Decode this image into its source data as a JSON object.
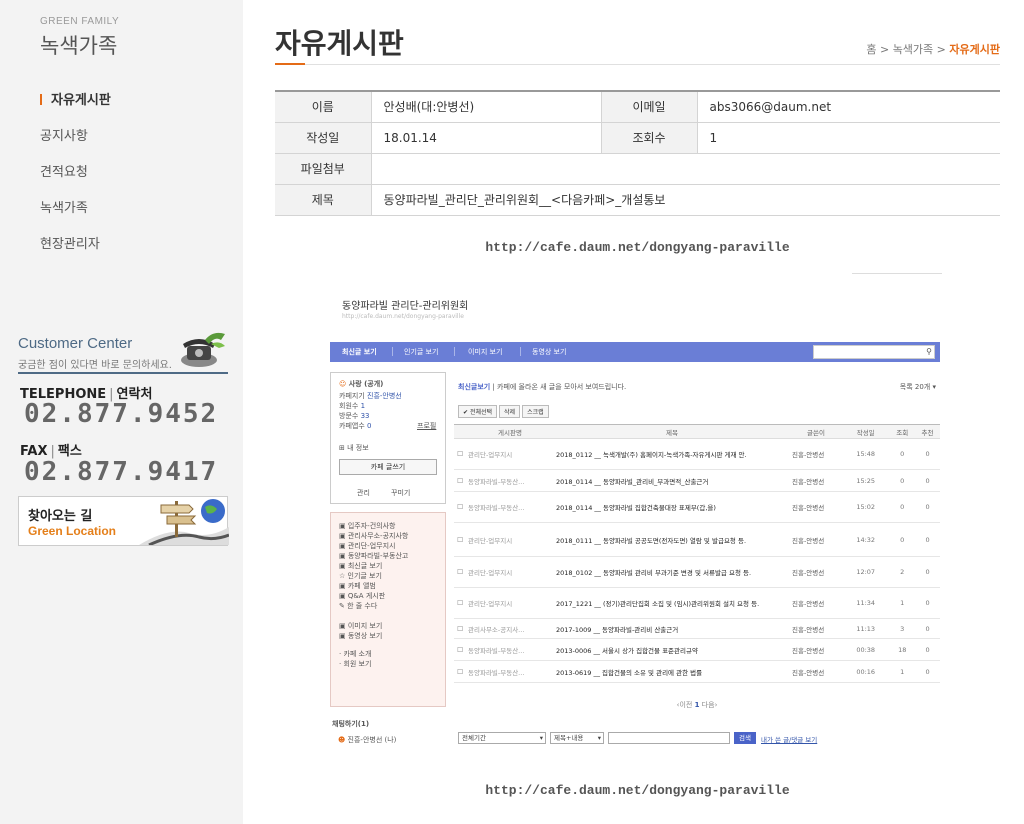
{
  "brand": {
    "en": "GREEN FAMILY",
    "ko": "녹색가족"
  },
  "sidebar": {
    "items": [
      {
        "label": "자유게시판",
        "active": true
      },
      {
        "label": "공지사항"
      },
      {
        "label": "견적요청"
      },
      {
        "label": "녹색가족"
      },
      {
        "label": "현장관리자"
      }
    ]
  },
  "customer_center": {
    "title": "Customer Center",
    "subtitle": "궁금한 점이 있다면 바로 문의하세요.",
    "telephone_label_en": "TELEPHONE",
    "telephone_label_ko": "연락처",
    "telephone": "02.877.9452",
    "fax_label_en": "FAX",
    "fax_label_ko": "팩스",
    "fax": "02.877.9417"
  },
  "location_banner": {
    "ko": "찾아오는 길",
    "en": "Green Location"
  },
  "page": {
    "title": "자유게시판",
    "breadcrumb": {
      "home": "홈",
      "sep": ">",
      "parent": "녹색가족",
      "current": "자유게시판"
    }
  },
  "post": {
    "name_label": "이름",
    "name": "안성배(대:안병선)",
    "email_label": "이메일",
    "email": "abs3066@daum.net",
    "date_label": "작성일",
    "date": "18.01.14",
    "views_label": "조회수",
    "views": "1",
    "attachment_label": "파일첨부",
    "attachment": "",
    "subject_label": "제목",
    "subject": "동양파라빌_관리단_관리위원회__<다음카페>_개설통보",
    "url": "http://cafe.daum.net/dongyang-paraville"
  },
  "cafe": {
    "title": "동양파라빌 관리단-관리위원회",
    "url": "http://cafe.daum.net/dongyang-paraville",
    "nav": [
      "최신글 보기",
      "인기글 보기",
      "이미지 보기",
      "동영상 보기"
    ],
    "profile": {
      "status": "사랑 (공개)",
      "manager_label": "카페지기",
      "manager": "진흥-안병선",
      "members_label": "회원수",
      "members": "1",
      "visits_label": "방문수",
      "visits": "33",
      "apps_label": "카페앱수",
      "apps": "0",
      "promo": "프로필",
      "myinfo": "내 정보",
      "write_btn": "카페 글쓰기",
      "manage": "관리",
      "decorate": "꾸미기"
    },
    "menu_group1": [
      "입주자-건의사항",
      "관리사무소-공지사항",
      "관리단-업무지시",
      "동양파라빌-부동산고",
      "최신글 보기",
      "인기글 보기",
      "카페 앨범",
      "Q&A 게시판",
      "한 줄 수다"
    ],
    "menu_group2": [
      "이미지 보기",
      "동영상 보기"
    ],
    "menu_group3": [
      "카페 소개",
      "회원 보기"
    ],
    "rank_title": "채팅하기(1)",
    "rank_user": "진흥-안병선 (나)",
    "header": "최신글보기",
    "header_desc": "카페에 올라온 새 글을 모아서 보여드립니다.",
    "sort": "목록 20개",
    "tools": [
      "전체선택",
      "삭제",
      "스크랩"
    ],
    "columns": [
      "게시판명",
      "제목",
      "글쓴이",
      "작성일",
      "조회",
      "추천"
    ],
    "rows": [
      {
        "board": "관리단-업무지시",
        "subject": "2018_0112 __ 녹색개발(주) 홈페이지-녹색가족-자유게시판 게재 안.",
        "author": "진흥-안병선",
        "time": "15:48",
        "views": "0",
        "likes": "0"
      },
      {
        "board": "동양파라빌-부동산...",
        "subject": "2018_0114 __ 동양파라빌_관리비_부과면적_산출근거",
        "author": "진흥-안병선",
        "time": "15:25",
        "views": "0",
        "likes": "0"
      },
      {
        "board": "동양파라빌-부동산...",
        "subject": "2018_0114 __ 동양파라빌 집합건축물대장 표제부(갑,을)",
        "author": "진흥-안병선",
        "time": "15:02",
        "views": "0",
        "likes": "0"
      },
      {
        "board": "관리단-업무지시",
        "subject": "2018_0111 __ 동양파라빌 공공도면(전자도면) 열람 및 발급요청 등.",
        "author": "진흥-안병선",
        "time": "14:32",
        "views": "0",
        "likes": "0"
      },
      {
        "board": "관리단-업무지시",
        "subject": "2018_0102 __ 동양파라빌 관리비 부과기준 변경 및 서류발급 요청 등.",
        "author": "진흥-안병선",
        "time": "12:07",
        "views": "2",
        "likes": "0"
      },
      {
        "board": "관리단-업무지시",
        "subject": "2017_1221 __ (정기)관리단집회 소집 및 (임시)관리위원회 설치 요청 등.",
        "author": "진흥-안병선",
        "time": "11:34",
        "views": "1",
        "likes": "0"
      },
      {
        "board": "관리사무소-공지사...",
        "subject": "2017-1009 __ 동양파라빌-관리비 산출근거",
        "author": "진흥-안병선",
        "time": "11:13",
        "views": "3",
        "likes": "0"
      },
      {
        "board": "동양파라빌-부동산...",
        "subject": "2013-0006 __ 서울시 상가 집합건물 표준관리규약",
        "author": "진흥-안병선",
        "time": "00:38",
        "views": "18",
        "likes": "0"
      },
      {
        "board": "동양파라빌-부동산...",
        "subject": "2013-0619 __ 집합건물의 소유 및 관리에 관한 법률",
        "author": "진흥-안병선",
        "time": "00:16",
        "views": "1",
        "likes": "0"
      }
    ],
    "pager": {
      "prev": "이전",
      "current": "1",
      "next": "다음"
    },
    "search": {
      "period": "전체기간",
      "scope": "제목+내용",
      "button": "검색",
      "mine": "내가 쓴 글/댓글 보기"
    }
  },
  "colors": {
    "accent": "#e46b17",
    "cafe_nav": "#6a7ed6",
    "sidebar_bg": "#f3f3f3"
  }
}
